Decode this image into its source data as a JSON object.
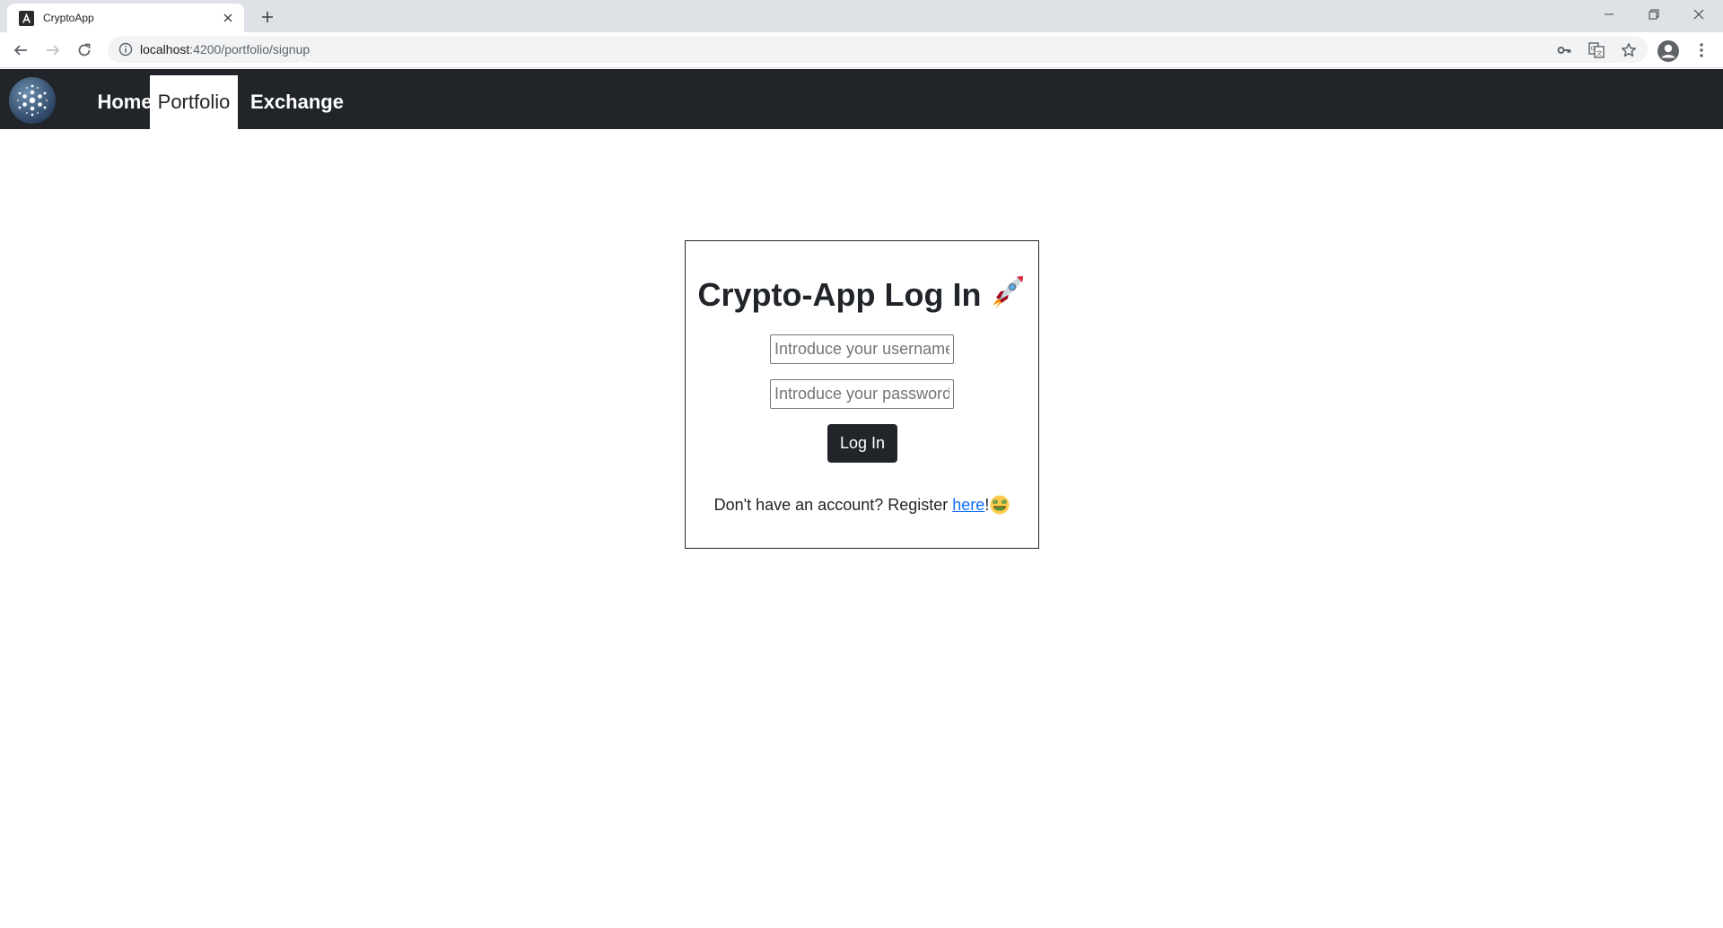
{
  "browser": {
    "tab_title": "CryptoApp",
    "url_host": "localhost",
    "url_path": ":4200/portfolio/signup"
  },
  "navbar": {
    "items": [
      {
        "label": "Home",
        "active": false
      },
      {
        "label": "Portfolio",
        "active": true
      },
      {
        "label": "Exchange",
        "active": false
      }
    ]
  },
  "login": {
    "title": "Crypto-App Log In",
    "username_placeholder": "Introduce your username",
    "password_placeholder": "Introduce your password",
    "button_label": "Log In",
    "register_prefix": "Don't have an account? Register ",
    "register_link": "here",
    "register_suffix": "!"
  },
  "colors": {
    "navbar_bg": "#212529",
    "link": "#0d6efd",
    "tabstrip_bg": "#dee1e6"
  }
}
